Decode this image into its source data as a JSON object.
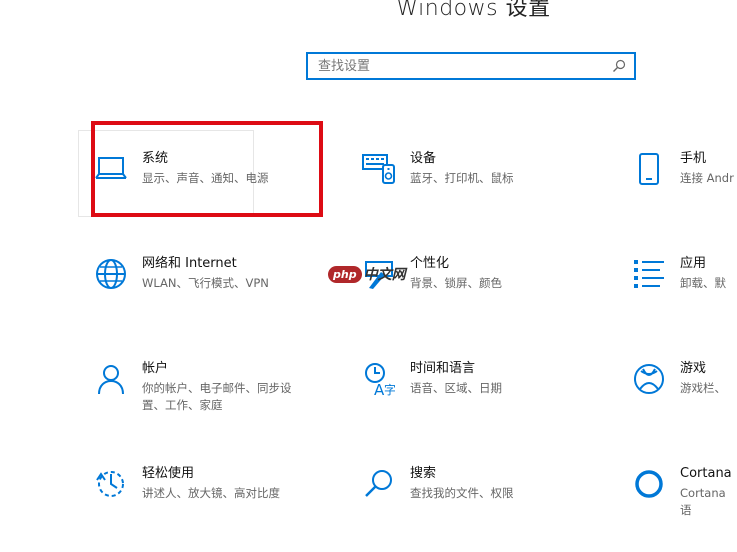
{
  "header": {
    "title": "Windows 设置"
  },
  "search": {
    "placeholder": "查找设置"
  },
  "tiles": [
    {
      "name": "系统",
      "desc": "显示、声音、通知、电源",
      "icon": "laptop-icon"
    },
    {
      "name": "设备",
      "desc": "蓝牙、打印机、鼠标",
      "icon": "keyboard-devices-icon"
    },
    {
      "name": "手机",
      "desc": "连接 Andr",
      "icon": "phone-icon"
    },
    {
      "name": "网络和 Internet",
      "desc": "WLAN、飞行模式、VPN",
      "icon": "globe-icon"
    },
    {
      "name": "个性化",
      "desc": "背景、锁屏、颜色",
      "icon": "paintbrush-icon"
    },
    {
      "name": "应用",
      "desc": "卸载、默",
      "icon": "apps-list-icon"
    },
    {
      "name": "帐户",
      "desc": "你的帐户、电子邮件、同步设置、工作、家庭",
      "icon": "person-icon"
    },
    {
      "name": "时间和语言",
      "desc": "语音、区域、日期",
      "icon": "time-language-icon"
    },
    {
      "name": "游戏",
      "desc": "游戏栏、",
      "icon": "xbox-icon"
    },
    {
      "name": "轻松使用",
      "desc": "讲述人、放大镜、高对比度",
      "icon": "ease-of-access-icon"
    },
    {
      "name": "搜索",
      "desc": "查找我的文件、权限",
      "icon": "search-icon"
    },
    {
      "name": "Cortana",
      "desc": "Cortana 语",
      "icon": "cortana-icon"
    }
  ],
  "watermark": {
    "badge": "php",
    "text": "中文网"
  },
  "colors": {
    "accent": "#0078d7",
    "highlight": "#dd0b14"
  }
}
